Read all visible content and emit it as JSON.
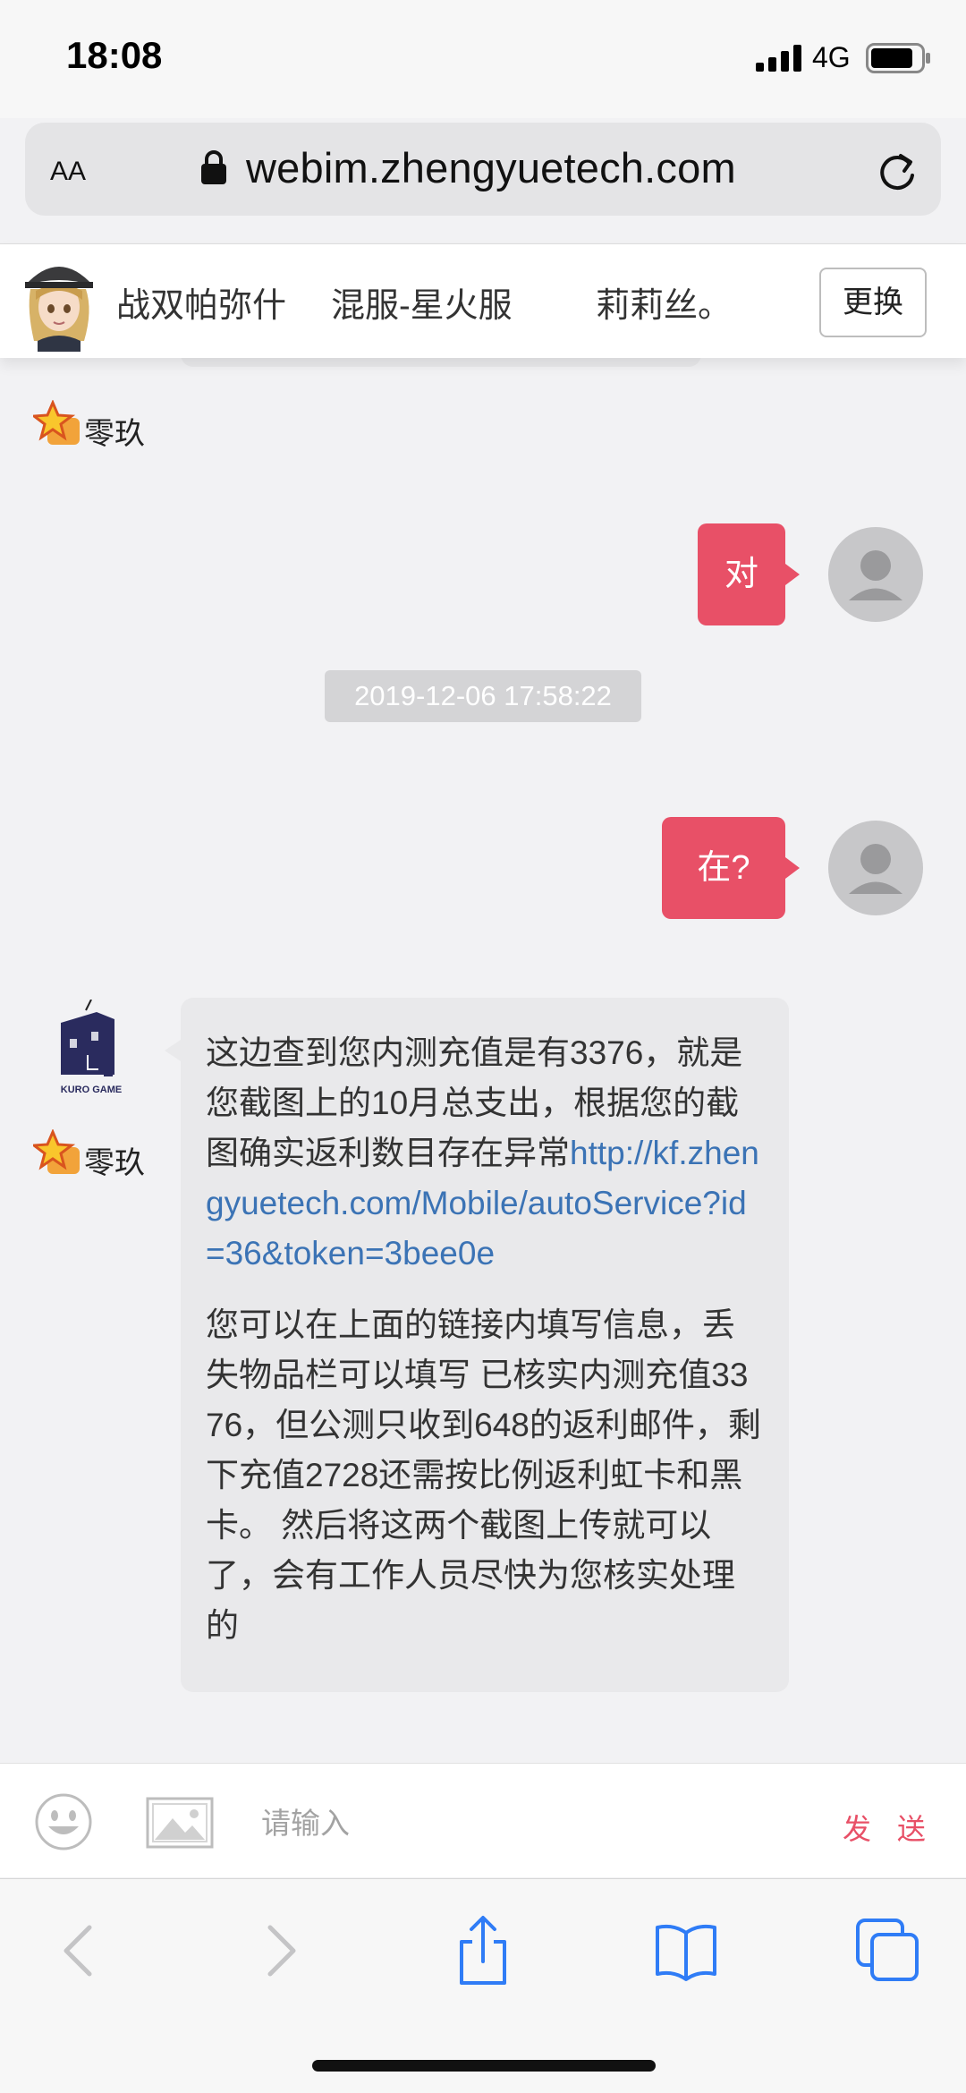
{
  "status_bar": {
    "time": "18:08",
    "network": "4G",
    "signal_icon": "signal-bars-icon",
    "battery_icon": "battery-icon"
  },
  "browser": {
    "text_size_label": "AA",
    "url": "webim.zhengyuetech.com",
    "lock_icon": "lock-icon",
    "reload_icon": "reload-icon"
  },
  "header": {
    "tabs": [
      "战双帕弥什",
      "混服-星火服",
      "莉莉丝。"
    ],
    "change_label": "更换"
  },
  "chat": {
    "agent_name_top": "零玖",
    "user_msg_1": "对",
    "timestamp": "2019-12-06 17:58:22",
    "user_msg_2": "在?",
    "agent_name": "零玖",
    "agent_logo_text": "KURO GAME",
    "agent_msg_text": "这边查到您内测充值是有3376，就是您截图上的10月总支出，根据您的截图确实返利数目存在异常",
    "agent_msg_link": "http://kf.zhengyuetech.com/Mobile/autoService?id=36&token=3bee0e",
    "agent_msg_text_2": "您可以在上面的链接内填写信息，丢失物品栏可以填写 已核实内测充值3376，但公测只收到648的返利邮件，剩下充值2728还需按比例返利虹卡和黑卡。 然后将这两个截图上传就可以了，会有工作人员尽快为您核实处理的"
  },
  "input_bar": {
    "placeholder": "请输入",
    "send_label": "发 送"
  },
  "toolbar": {
    "icons": [
      "back-icon",
      "forward-icon",
      "share-icon",
      "bookmarks-icon",
      "tabs-icon"
    ]
  },
  "colors": {
    "accent": "#e85067",
    "link": "#3b73b5",
    "bubble_gray": "#e9e9eb",
    "ios_blue": "#2f7cf6"
  }
}
